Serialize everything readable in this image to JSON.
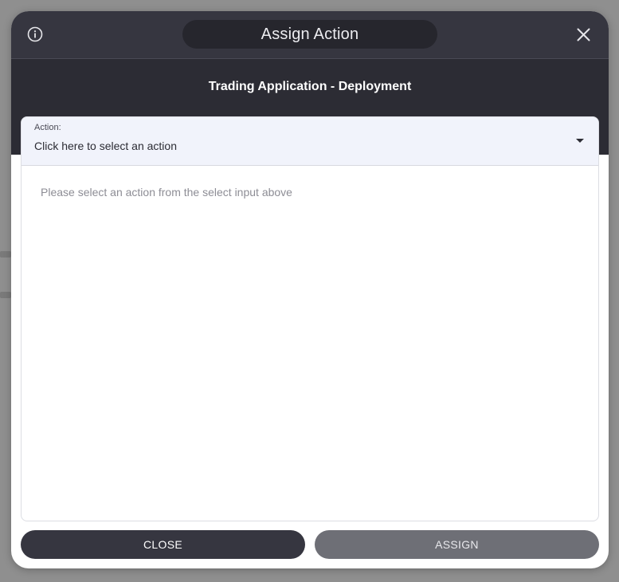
{
  "dialog": {
    "title": "Assign Action",
    "subtitle": "Trading Application - Deployment",
    "info_icon": "info-circle-icon",
    "close_icon": "close-icon"
  },
  "action_select": {
    "label": "Action:",
    "value": "Click here to select an action",
    "arrow_icon": "caret-down-icon"
  },
  "content": {
    "hint": "Please select an action from the select input above"
  },
  "footer": {
    "close_label": "CLOSE",
    "assign_label": "ASSIGN"
  },
  "colors": {
    "header": "#363640",
    "subheader": "#2c2c34",
    "select_bg": "#f1f3fb",
    "primary_button": "#363640",
    "disabled_button": "#6e6f76"
  }
}
